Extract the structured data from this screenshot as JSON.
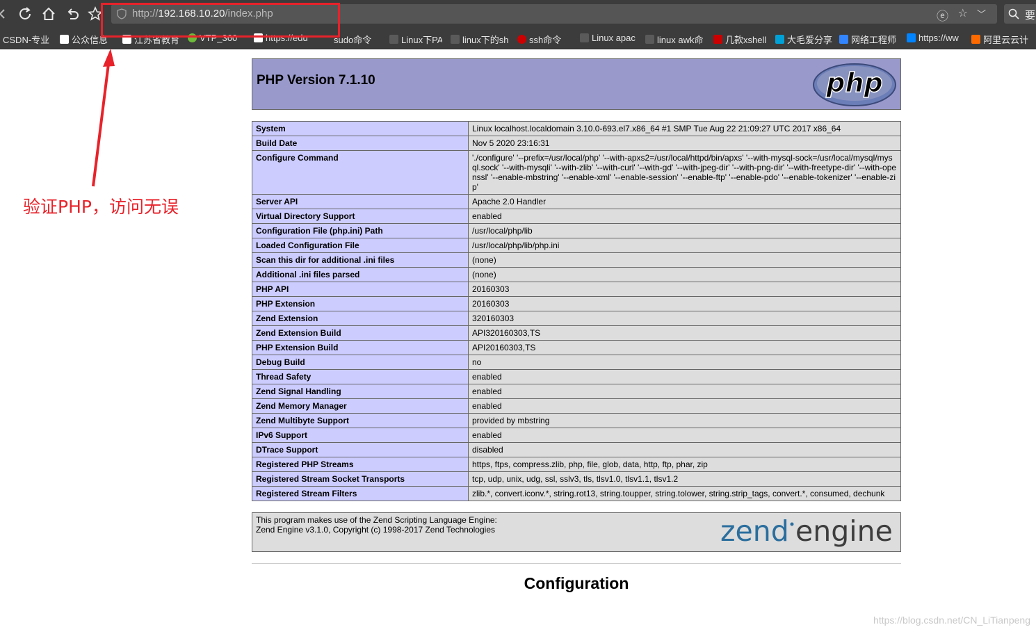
{
  "browser": {
    "url_prefix": "http://",
    "url_host": "192.168.10.20",
    "url_path": "/index.php",
    "search_text": "要",
    "bookmarks": [
      {
        "label": "CSDN-专业",
        "color": "#3c3c3c"
      },
      {
        "label": "公众信息",
        "color": "#ffffff"
      },
      {
        "label": "江苏省教育",
        "color": "#ffffff"
      },
      {
        "label": "VTP_360",
        "color": "#6dbb3a"
      },
      {
        "label": "https://edu",
        "color": "#ffffff"
      },
      {
        "label": "sudo命令",
        "color": "#777777"
      },
      {
        "label": "Linux下PA",
        "color": "#777777"
      },
      {
        "label": "linux下的sh",
        "color": "#777777"
      },
      {
        "label": "ssh命令",
        "color": "#cc0000"
      },
      {
        "label": "Linux apac",
        "color": "#777777"
      },
      {
        "label": "linux awk命",
        "color": "#777777"
      },
      {
        "label": "几款xshell",
        "color": "#cc0000"
      },
      {
        "label": "大毛爱分享",
        "color": "#00a1d6"
      },
      {
        "label": "网络工程师",
        "color": "#3385ff"
      },
      {
        "label": "https://ww",
        "color": "#0084ff"
      },
      {
        "label": "阿里云云计",
        "color": "#ff6a00"
      }
    ]
  },
  "annotation": {
    "note": "验证PHP，访问无误",
    "color": "#e8222a"
  },
  "phpinfo": {
    "title": "PHP Version 7.1.10",
    "logo_text": "php",
    "rows": [
      {
        "key": "System",
        "value": "Linux localhost.localdomain 3.10.0-693.el7.x86_64 #1 SMP Tue Aug 22 21:09:27 UTC 2017 x86_64"
      },
      {
        "key": "Build Date",
        "value": "Nov 5 2020 23:16:31"
      },
      {
        "key": "Configure Command",
        "value": "'./configure' '--prefix=/usr/local/php' '--with-apxs2=/usr/local/httpd/bin/apxs' '--with-mysql-sock=/usr/local/mysql/mysql.sock' '--with-mysqli' '--with-zlib' '--with-curl' '--with-gd' '--with-jpeg-dir' '--with-png-dir' '--with-freetype-dir' '--with-openssl' '--enable-mbstring' '--enable-xml' '--enable-session' '--enable-ftp' '--enable-pdo' '--enable-tokenizer' '--enable-zip'"
      },
      {
        "key": "Server API",
        "value": "Apache 2.0 Handler"
      },
      {
        "key": "Virtual Directory Support",
        "value": "enabled"
      },
      {
        "key": "Configuration File (php.ini) Path",
        "value": "/usr/local/php/lib"
      },
      {
        "key": "Loaded Configuration File",
        "value": "/usr/local/php/lib/php.ini"
      },
      {
        "key": "Scan this dir for additional .ini files",
        "value": "(none)"
      },
      {
        "key": "Additional .ini files parsed",
        "value": "(none)"
      },
      {
        "key": "PHP API",
        "value": "20160303"
      },
      {
        "key": "PHP Extension",
        "value": "20160303"
      },
      {
        "key": "Zend Extension",
        "value": "320160303"
      },
      {
        "key": "Zend Extension Build",
        "value": "API320160303,TS"
      },
      {
        "key": "PHP Extension Build",
        "value": "API20160303,TS"
      },
      {
        "key": "Debug Build",
        "value": "no"
      },
      {
        "key": "Thread Safety",
        "value": "enabled"
      },
      {
        "key": "Zend Signal Handling",
        "value": "enabled"
      },
      {
        "key": "Zend Memory Manager",
        "value": "enabled"
      },
      {
        "key": "Zend Multibyte Support",
        "value": "provided by mbstring"
      },
      {
        "key": "IPv6 Support",
        "value": "enabled"
      },
      {
        "key": "DTrace Support",
        "value": "disabled"
      },
      {
        "key": "Registered PHP Streams",
        "value": "https, ftps, compress.zlib, php, file, glob, data, http, ftp, phar, zip"
      },
      {
        "key": "Registered Stream Socket Transports",
        "value": "tcp, udp, unix, udg, ssl, sslv3, tls, tlsv1.0, tlsv1.1, tlsv1.2"
      },
      {
        "key": "Registered Stream Filters",
        "value": "zlib.*, convert.iconv.*, string.rot13, string.toupper, string.tolower, string.strip_tags, convert.*, consumed, dechunk"
      }
    ],
    "zend_line1": "This program makes use of the Zend Scripting Language Engine:",
    "zend_line2": "Zend Engine v3.1.0, Copyright (c) 1998-2017 Zend Technologies",
    "zend_logo_left": "zend",
    "zend_logo_right": "engine",
    "config_heading": "Configuration"
  },
  "watermark": "https://blog.csdn.net/CN_LiTianpeng",
  "icons": {
    "back": "back-icon",
    "refresh": "refresh-icon",
    "home": "home-icon",
    "undo": "undo-icon",
    "favorite": "star-icon",
    "search": "search-icon"
  },
  "colors": {
    "php_header": "#9999cc",
    "key_cell": "#ccccff",
    "value_cell": "#dddddd",
    "zend_blue": "#2a6e9e"
  }
}
